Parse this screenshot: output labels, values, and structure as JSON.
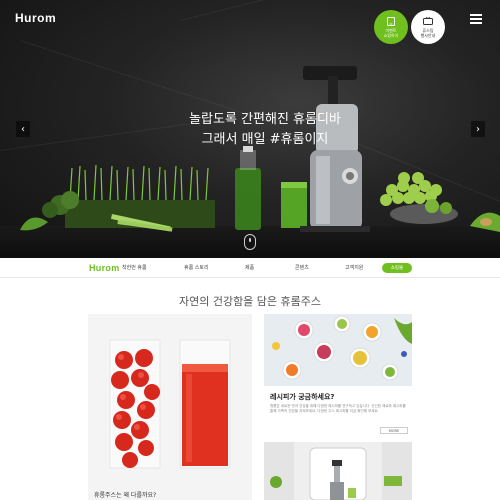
{
  "header": {
    "logo": "Hurom",
    "green_button_text": "이벤트\n쇼핑하기",
    "white_button_text": "휴스팅\n행사안내",
    "menu_icon": "hamburger-menu-icon"
  },
  "hero": {
    "headline_line1": "놀랍도록 간편해진 휴롬디바",
    "headline_line2": "그래서 매일 #휴롬이지",
    "prev_icon": "chevron-left-icon",
    "next_icon": "chevron-right-icon",
    "prev_glyph": "‹",
    "next_glyph": "›",
    "scroll_icon": "mouse-scroll-icon"
  },
  "navbar": {
    "logo": "Hurom",
    "items": [
      "착한번 휴롬",
      "휴롬 스토리",
      "제품",
      "콘텐츠",
      "고객지원"
    ],
    "shop_label": "쇼핑몰",
    "accent_color": "#6fbf1f"
  },
  "main": {
    "section_title": "자연의 건강함을 담은 휴롬주스",
    "card_glasses": {
      "caption": "휴롬주스는 왜 다를까요?"
    },
    "card_recipe": {
      "title": "레시피가 궁금하세요?",
      "description": "휴롬은 새로운 맛과 건강을 위해 다양한 레시피를 연구하고 있습니다. 신선한 재료와 레시피를 통해 가족의 건강을 지켜보세요. 다양한 주스 레시피를 지금 확인해 보세요.",
      "more_label": "MORE"
    }
  }
}
